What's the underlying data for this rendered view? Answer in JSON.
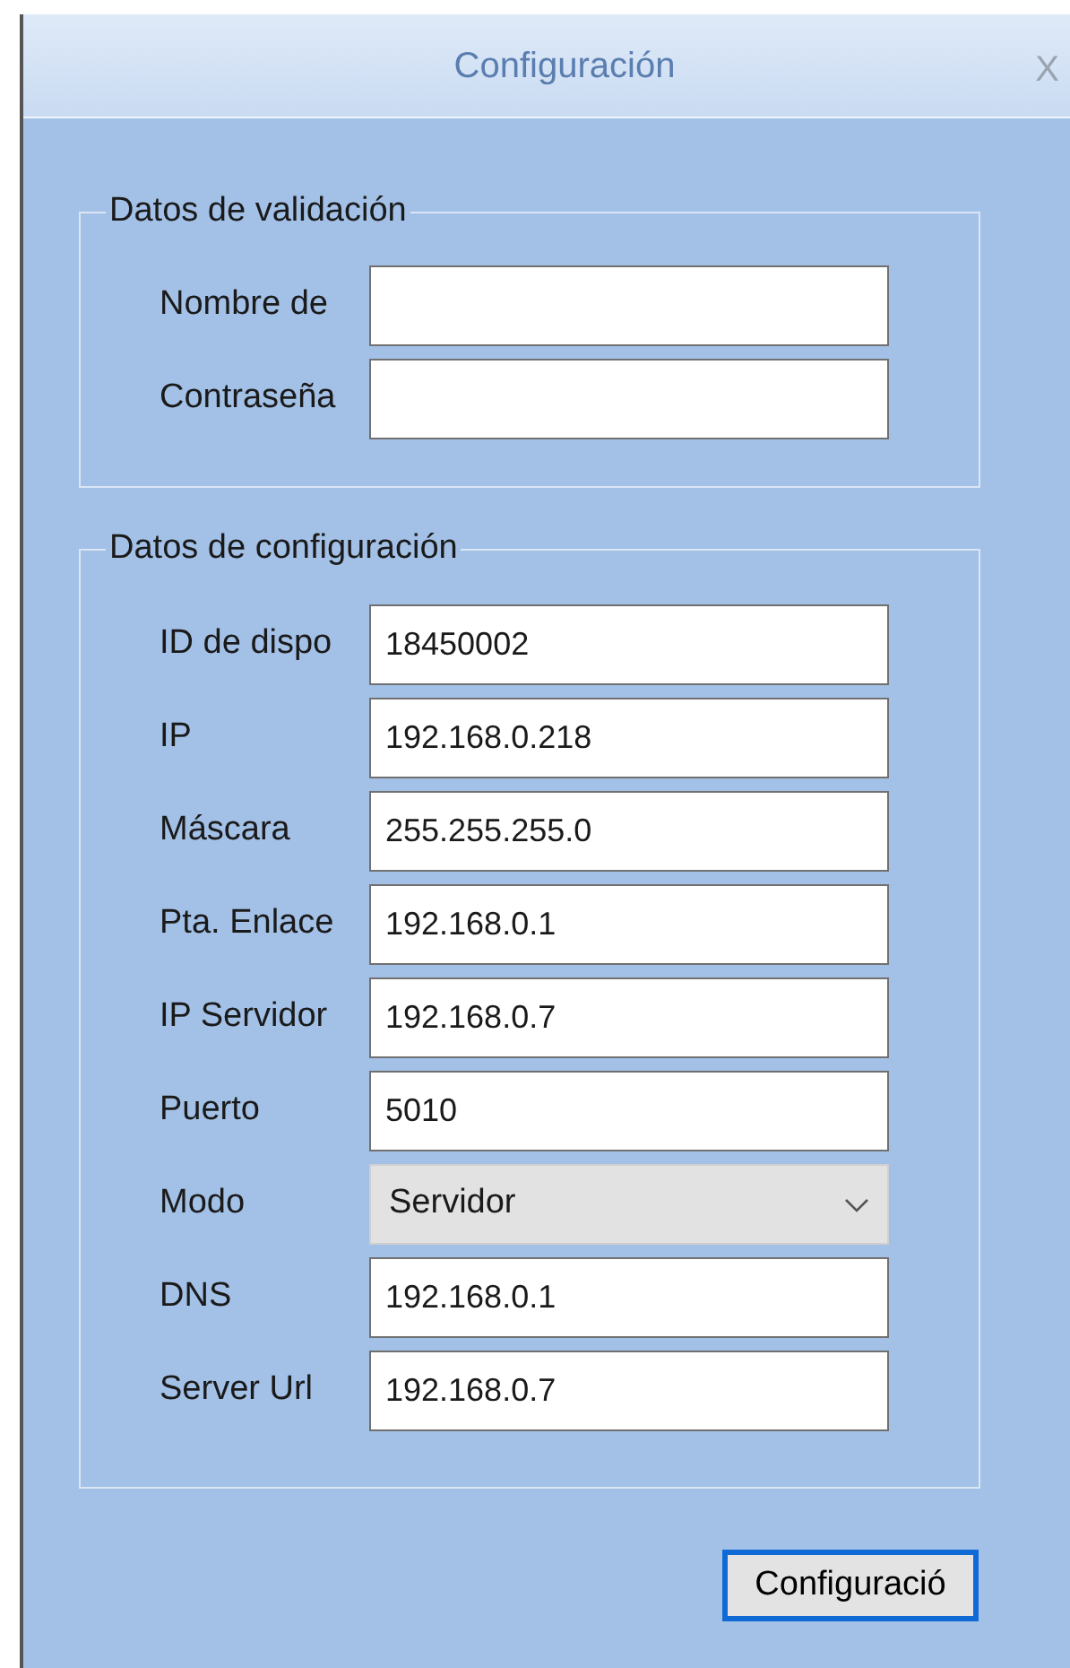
{
  "window": {
    "title": "Configuración",
    "close": "X"
  },
  "groups": [
    {
      "title": "Datos de validación",
      "fields": [
        {
          "label": "Nombre de",
          "kind": "text"
        },
        {
          "label": "Contraseña",
          "kind": "text"
        }
      ]
    },
    {
      "title": "Datos de configuración",
      "fields": [
        {
          "label": "ID de dispo",
          "kind": "text",
          "value": "18450002"
        },
        {
          "label": "IP",
          "kind": "text",
          "value": "192.168.0.218"
        },
        {
          "label": "Máscara",
          "kind": "text",
          "value": "255.255.255.0"
        },
        {
          "label": "Pta. Enlace",
          "kind": "text",
          "value": "192.168.0.1"
        },
        {
          "label": "IP Servidor",
          "kind": "text",
          "value": "192.168.0.7"
        },
        {
          "label": "Puerto",
          "kind": "text",
          "value": "5010"
        },
        {
          "label": "Modo",
          "kind": "select",
          "value": "Servidor"
        },
        {
          "label": "DNS",
          "kind": "text",
          "value": "192.168.0.1"
        },
        {
          "label": "Server Url",
          "kind": "text",
          "value": "192.168.0.7"
        }
      ]
    }
  ],
  "button": {
    "label": "Configuració",
    "focused": true
  }
}
